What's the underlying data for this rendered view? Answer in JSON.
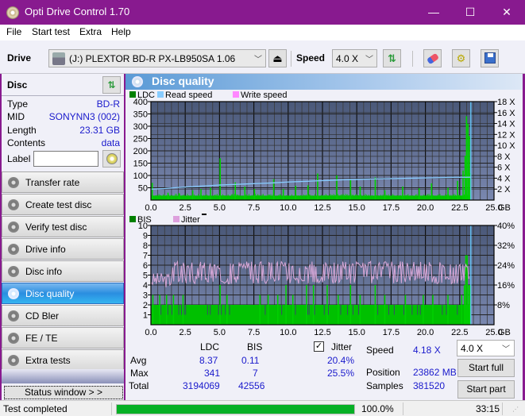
{
  "window": {
    "title": "Opti Drive Control 1.70",
    "minimize": "—",
    "maximize": "☐",
    "close": "✕"
  },
  "menu": {
    "items": [
      {
        "label": "File",
        "accel": "F"
      },
      {
        "label": "Start test",
        "accel": "S"
      },
      {
        "label": "Extra",
        "accel": "x"
      },
      {
        "label": "Help",
        "accel": "H"
      }
    ]
  },
  "toolbar": {
    "drive_label": "Drive",
    "drive_value": "(J:)  PLEXTOR BD-R  PX-LB950SA 1.06",
    "speed_label": "Speed",
    "speed_value": "4.0 X",
    "icons": [
      "eject-icon",
      "refresh-icon",
      "erase-icon",
      "settings-icon",
      "save-icon"
    ]
  },
  "disc": {
    "header": "Disc",
    "fields": [
      {
        "key": "Type",
        "value": "BD-R"
      },
      {
        "key": "MID",
        "value": "SONYNN3 (002)"
      },
      {
        "key": "Length",
        "value": "23.31 GB"
      },
      {
        "key": "Contents",
        "value": "data"
      }
    ],
    "label_key": "Label",
    "label_value": ""
  },
  "nav": {
    "items": [
      {
        "label": "Transfer rate",
        "active": false
      },
      {
        "label": "Create test disc",
        "active": false
      },
      {
        "label": "Verify test disc",
        "active": false
      },
      {
        "label": "Drive info",
        "active": false
      },
      {
        "label": "Disc info",
        "active": false
      },
      {
        "label": "Disc quality",
        "active": true
      },
      {
        "label": "CD Bler",
        "active": false
      },
      {
        "label": "FE / TE",
        "active": false
      },
      {
        "label": "Extra tests",
        "active": false
      }
    ],
    "status_window": "Status window > >"
  },
  "panel": {
    "title": "Disc quality"
  },
  "chart_data": [
    {
      "type": "bar",
      "title": "LDC / Read speed",
      "legend": [
        "LDC",
        "Read speed",
        "Write speed"
      ],
      "legend_colors": [
        "#008000",
        "#88ccff",
        "#ff88ff"
      ],
      "legend_placement": "top-left",
      "xlabel": "GB",
      "x_ticks": [
        "0.0",
        "2.5",
        "5.0",
        "7.5",
        "10.0",
        "12.5",
        "15.0",
        "17.5",
        "20.0",
        "22.5",
        "25.0"
      ],
      "xlim": [
        0,
        25
      ],
      "ylim": [
        0,
        400
      ],
      "y_ticks": [
        "50",
        "100",
        "150",
        "200",
        "250",
        "300",
        "350",
        "400"
      ],
      "y2_ticks": [
        "2 X",
        "4 X",
        "6 X",
        "8 X",
        "10 X",
        "12 X",
        "14 X",
        "16 X",
        "18 X"
      ],
      "y2lim": [
        0,
        18
      ],
      "grid": true,
      "end_marker_gb": 23.31,
      "ldc_baseline": 18,
      "ldc_spikes": [
        {
          "x": 0.05,
          "y": 70
        },
        {
          "x": 1.2,
          "y": 30
        },
        {
          "x": 2.0,
          "y": 28
        },
        {
          "x": 3.0,
          "y": 40
        },
        {
          "x": 3.6,
          "y": 45
        },
        {
          "x": 4.3,
          "y": 50
        },
        {
          "x": 5.0,
          "y": 170
        },
        {
          "x": 6.1,
          "y": 72
        },
        {
          "x": 6.8,
          "y": 55
        },
        {
          "x": 7.5,
          "y": 45
        },
        {
          "x": 8.9,
          "y": 85
        },
        {
          "x": 9.6,
          "y": 45
        },
        {
          "x": 10.5,
          "y": 58
        },
        {
          "x": 11.4,
          "y": 60
        },
        {
          "x": 12.1,
          "y": 108
        },
        {
          "x": 13.5,
          "y": 100
        },
        {
          "x": 14.5,
          "y": 85
        },
        {
          "x": 15.2,
          "y": 55
        },
        {
          "x": 16.3,
          "y": 92
        },
        {
          "x": 17.0,
          "y": 40
        },
        {
          "x": 18.3,
          "y": 55
        },
        {
          "x": 19.5,
          "y": 48
        },
        {
          "x": 20.4,
          "y": 68
        },
        {
          "x": 21.6,
          "y": 50
        },
        {
          "x": 22.3,
          "y": 78
        },
        {
          "x": 22.7,
          "y": 120
        },
        {
          "x": 22.85,
          "y": 180
        },
        {
          "x": 22.95,
          "y": 341
        },
        {
          "x": 23.05,
          "y": 310
        },
        {
          "x": 23.15,
          "y": 260
        },
        {
          "x": 23.25,
          "y": 110
        }
      ],
      "read_speed": [
        {
          "x": 0.0,
          "y": 2.0
        },
        {
          "x": 1.0,
          "y": 2.1
        },
        {
          "x": 2.0,
          "y": 2.3
        },
        {
          "x": 3.0,
          "y": 2.45
        },
        {
          "x": 4.0,
          "y": 2.6
        },
        {
          "x": 5.0,
          "y": 2.75
        },
        {
          "x": 6.0,
          "y": 2.85
        },
        {
          "x": 7.0,
          "y": 2.95
        },
        {
          "x": 8.0,
          "y": 3.05
        },
        {
          "x": 9.0,
          "y": 3.15
        },
        {
          "x": 10.0,
          "y": 3.3
        },
        {
          "x": 11.0,
          "y": 3.4
        },
        {
          "x": 12.0,
          "y": 3.5
        },
        {
          "x": 13.0,
          "y": 3.6
        },
        {
          "x": 14.0,
          "y": 3.7
        },
        {
          "x": 15.0,
          "y": 3.75
        },
        {
          "x": 16.0,
          "y": 3.85
        },
        {
          "x": 17.0,
          "y": 3.9
        },
        {
          "x": 18.0,
          "y": 3.95
        },
        {
          "x": 19.0,
          "y": 4.0
        },
        {
          "x": 20.0,
          "y": 4.05
        },
        {
          "x": 21.0,
          "y": 4.1
        },
        {
          "x": 22.0,
          "y": 4.15
        },
        {
          "x": 23.31,
          "y": 4.18
        }
      ]
    },
    {
      "type": "bar",
      "title": "BIS / Jitter",
      "legend": [
        "BIS",
        "Jitter"
      ],
      "legend_colors": [
        "#008000",
        "#dda0dd"
      ],
      "legend_placement": "top-left",
      "xlabel": "GB",
      "x_ticks": [
        "0.0",
        "2.5",
        "5.0",
        "7.5",
        "10.0",
        "12.5",
        "15.0",
        "17.5",
        "20.0",
        "22.5",
        "25.0"
      ],
      "xlim": [
        0,
        25
      ],
      "ylim": [
        0,
        10
      ],
      "y_ticks": [
        "1",
        "2",
        "3",
        "4",
        "5",
        "6",
        "7",
        "8",
        "9",
        "10"
      ],
      "y2_ticks": [
        "8%",
        "16%",
        "24%",
        "32%",
        "40%"
      ],
      "y2lim": [
        0,
        40
      ],
      "grid": true,
      "end_marker_gb": 23.31,
      "bis_baseline": 2,
      "bis_spikes": [
        {
          "x": 0.1,
          "y": 3
        },
        {
          "x": 0.6,
          "y": 3
        },
        {
          "x": 1.1,
          "y": 3
        },
        {
          "x": 1.6,
          "y": 3
        },
        {
          "x": 2.3,
          "y": 3
        },
        {
          "x": 5.0,
          "y": 4
        },
        {
          "x": 5.5,
          "y": 3
        },
        {
          "x": 7.9,
          "y": 3
        },
        {
          "x": 8.5,
          "y": 3
        },
        {
          "x": 9.2,
          "y": 3
        },
        {
          "x": 9.8,
          "y": 4
        },
        {
          "x": 10.3,
          "y": 3
        },
        {
          "x": 11.3,
          "y": 4
        },
        {
          "x": 11.8,
          "y": 4
        },
        {
          "x": 12.8,
          "y": 4
        },
        {
          "x": 13.6,
          "y": 3
        },
        {
          "x": 14.5,
          "y": 4
        },
        {
          "x": 15.2,
          "y": 3
        },
        {
          "x": 16.3,
          "y": 4
        },
        {
          "x": 17.0,
          "y": 3
        },
        {
          "x": 18.5,
          "y": 3
        },
        {
          "x": 19.8,
          "y": 3
        },
        {
          "x": 20.5,
          "y": 3
        },
        {
          "x": 21.6,
          "y": 3
        },
        {
          "x": 22.6,
          "y": 3
        },
        {
          "x": 22.8,
          "y": 4
        },
        {
          "x": 22.9,
          "y": 7
        },
        {
          "x": 23.0,
          "y": 7
        },
        {
          "x": 23.1,
          "y": 4
        },
        {
          "x": 23.2,
          "y": 4
        }
      ],
      "jitter_range_pct": [
        16.5,
        25.5
      ],
      "jitter_avg_pct": 20.4
    }
  ],
  "stats": {
    "col_ldc": "LDC",
    "col_bis": "BIS",
    "row_avg": "Avg",
    "row_max": "Max",
    "row_total": "Total",
    "ldc_avg": "8.37",
    "ldc_max": "341",
    "ldc_total": "3194069",
    "bis_avg": "0.11",
    "bis_max": "7",
    "bis_total": "42556",
    "jitter_label": "Jitter",
    "jitter_checked": true,
    "jitter_avg": "20.4%",
    "jitter_max": "25.5%",
    "speed_label": "Speed",
    "speed_value": "4.18 X",
    "position_label": "Position",
    "position_value": "23862 MB",
    "samples_label": "Samples",
    "samples_value": "381520",
    "speed_select": "4.0 X",
    "start_full": "Start full",
    "start_part": "Start part"
  },
  "statusbar": {
    "status": "Test completed",
    "progress_pct": 100,
    "progress_text": "100.0%",
    "time": "33:15"
  }
}
